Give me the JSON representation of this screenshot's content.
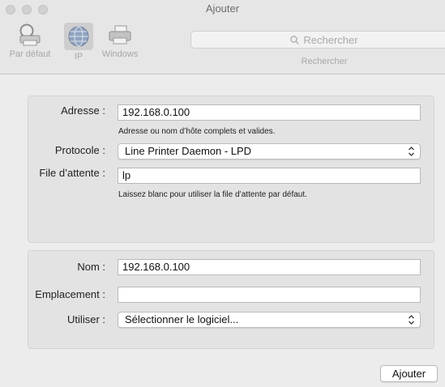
{
  "window": {
    "title": "Ajouter"
  },
  "toolbar": {
    "default_label": "Par défaut",
    "ip_label": "IP",
    "windows_label": "Windows",
    "selected": "IP"
  },
  "search": {
    "placeholder": "Rechercher",
    "caption": "Rechercher"
  },
  "form": {
    "address": {
      "label": "Adresse :",
      "value": "192.168.0.100",
      "hint": "Adresse ou nom d’hôte complets et valides."
    },
    "protocol": {
      "label": "Protocole :",
      "value": "Line Printer Daemon - LPD"
    },
    "queue": {
      "label": "File d’attente :",
      "value": "lp",
      "hint": "Laissez blanc pour utiliser la file d’attente par défaut."
    },
    "name": {
      "label": "Nom :",
      "value": "192.168.0.100"
    },
    "location": {
      "label": "Emplacement :",
      "value": ""
    },
    "use": {
      "label": "Utiliser :",
      "value": "Sélectionner le logiciel..."
    }
  },
  "actions": {
    "add_label": "Ajouter"
  }
}
